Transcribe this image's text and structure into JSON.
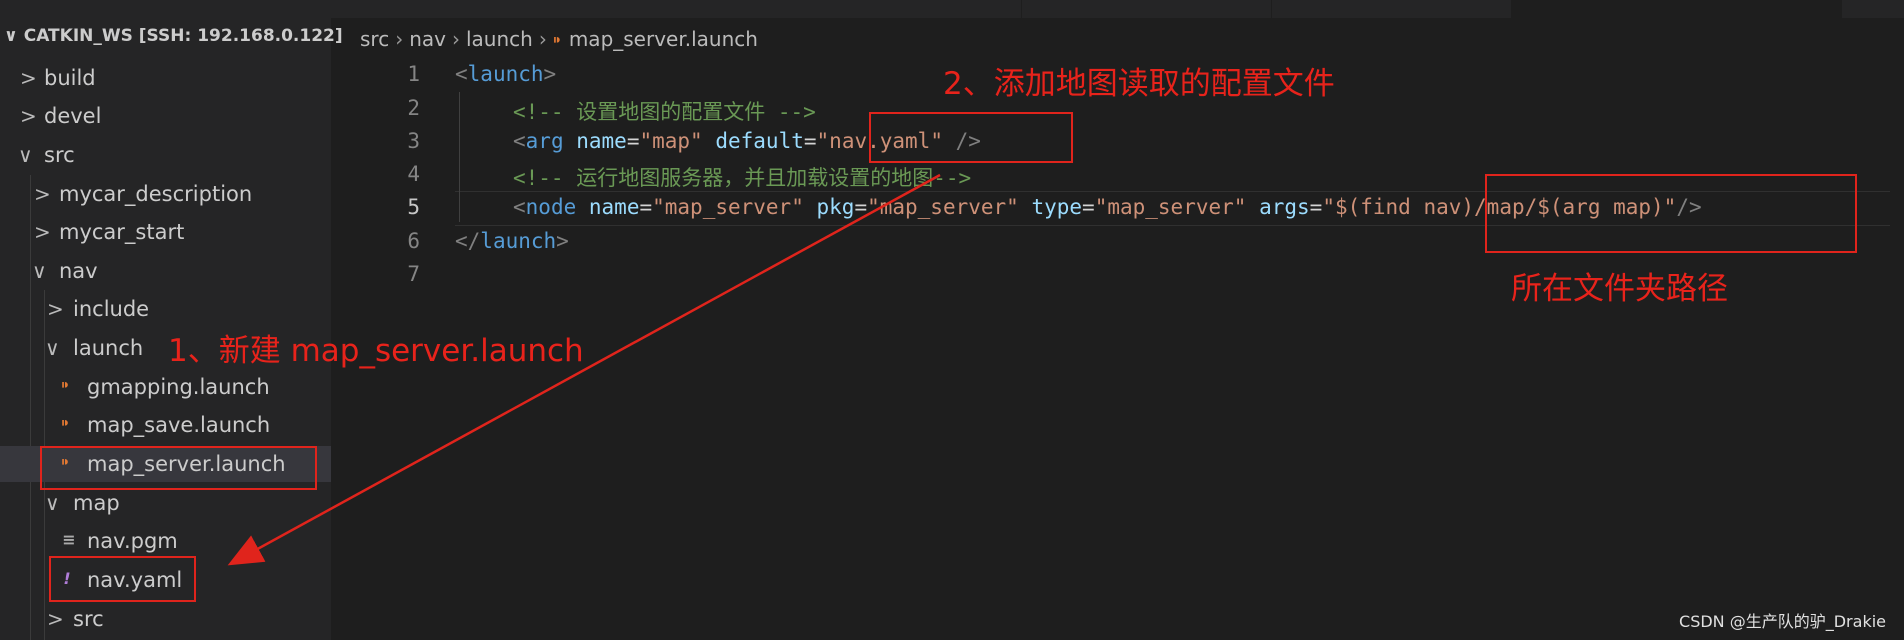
{
  "explorer": {
    "workspace_title": "CATKIN_WS [SSH: 192.168.0.122]",
    "items": [
      {
        "label": "build",
        "chevron": ">",
        "icon": ""
      },
      {
        "label": "devel",
        "chevron": ">",
        "icon": ""
      },
      {
        "label": "src",
        "chevron": "∨",
        "icon": ""
      },
      {
        "label": "mycar_description",
        "chevron": ">",
        "icon": ""
      },
      {
        "label": "mycar_start",
        "chevron": ">",
        "icon": ""
      },
      {
        "label": "nav",
        "chevron": "∨",
        "icon": ""
      },
      {
        "label": "include",
        "chevron": ">",
        "icon": ""
      },
      {
        "label": "launch",
        "chevron": "∨",
        "icon": ""
      },
      {
        "label": "gmapping.launch",
        "chevron": "",
        "icon": "rss-icon"
      },
      {
        "label": "map_save.launch",
        "chevron": "",
        "icon": "rss-icon"
      },
      {
        "label": "map_server.launch",
        "chevron": "",
        "icon": "rss-icon"
      },
      {
        "label": "map",
        "chevron": "∨",
        "icon": ""
      },
      {
        "label": "nav.pgm",
        "chevron": "",
        "icon": "lines-icon"
      },
      {
        "label": "nav.yaml",
        "chevron": "",
        "icon": "exclamation-icon"
      },
      {
        "label": "src",
        "chevron": ">",
        "icon": ""
      }
    ]
  },
  "breadcrumb": {
    "parts": [
      "src",
      "nav",
      "launch"
    ],
    "file": "map_server.launch"
  },
  "editor": {
    "line_numbers": [
      "1",
      "2",
      "3",
      "4",
      "5",
      "6",
      "7"
    ],
    "lines": {
      "l1": {
        "open": "<",
        "tag": "launch",
        "close": ">"
      },
      "l2": {
        "comment": "<!-- 设置地图的配置文件 -->"
      },
      "l3": {
        "open": "<",
        "tag": "arg",
        "a1": "name",
        "v1": "\"map\"",
        "a2": "default",
        "v2": "\"nav.yaml\"",
        "close": " />"
      },
      "l4": {
        "comment": "<!-- 运行地图服务器，并且加载设置的地图-->"
      },
      "l5": {
        "open": "<",
        "tag": "node",
        "a1": "name",
        "v1": "\"map_server\"",
        "a2": "pkg",
        "v2": "\"map_server\"",
        "a3": "type",
        "v3": "\"map_server\"",
        "a4": "args",
        "v4": "\"$(find nav)/map/$(arg map)\"",
        "close": "/>"
      },
      "l6": {
        "open": "</",
        "tag": "launch",
        "close": ">"
      },
      "l7": {}
    }
  },
  "annotations": {
    "step1": "1、新建 map_server.launch",
    "step2": "2、添加地图读取的配置文件",
    "folder_path": "所在文件夹路径"
  },
  "watermark": "CSDN @生产队的驴_Drakie",
  "colors": {
    "annotation_red": "#e0241c",
    "editor_bg": "#1e1e1e",
    "sidebar_bg": "#252526",
    "tag_blue": "#569cd6",
    "attr_lightblue": "#9cdcfe",
    "string_orange": "#ce9178",
    "comment_green": "#6a9955"
  }
}
